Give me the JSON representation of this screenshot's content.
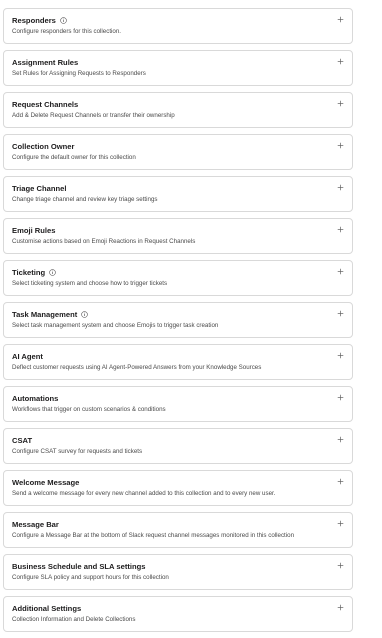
{
  "settings": [
    {
      "title": "Responders",
      "description": "Configure responders for this collection.",
      "has_info": true,
      "expand_icon": "plus-icon"
    },
    {
      "title": "Assignment Rules",
      "description": "Set Rules for Assigning Requests to Responders",
      "has_info": false,
      "expand_icon": "plus-icon"
    },
    {
      "title": "Request Channels",
      "description": "Add & Delete Request Channels or transfer their ownership",
      "has_info": false,
      "expand_icon": "plus-icon"
    },
    {
      "title": "Collection Owner",
      "description": "Configure the default owner for this collection",
      "has_info": false,
      "expand_icon": "plus-icon"
    },
    {
      "title": "Triage Channel",
      "description": "Change triage channel and review key triage settings",
      "has_info": false,
      "expand_icon": "plus-icon"
    },
    {
      "title": "Emoji Rules",
      "description": "Customise actions based on Emoji Reactions in Request Channels",
      "has_info": false,
      "expand_icon": "plus-icon"
    },
    {
      "title": "Ticketing",
      "description": "Select ticketing system and choose how to trigger tickets",
      "has_info": true,
      "expand_icon": "plus-icon"
    },
    {
      "title": "Task Management",
      "description": "Select task management system and choose Emojis to trigger task creation",
      "has_info": true,
      "expand_icon": "plus-icon"
    },
    {
      "title": "AI Agent",
      "description": "Deflect customer requests using AI Agent-Powered Answers from your Knowledge Sources",
      "has_info": false,
      "expand_icon": "plus-icon"
    },
    {
      "title": "Automations",
      "description": "Workflows that trigger on custom scenarios & conditions",
      "has_info": false,
      "expand_icon": "plus-icon"
    },
    {
      "title": "CSAT",
      "description": "Configure CSAT survey for requests and tickets",
      "has_info": false,
      "expand_icon": "plus-icon"
    },
    {
      "title": "Welcome Message",
      "description": "Send a welcome message for every new channel added to this collection and to every new user.",
      "has_info": false,
      "expand_icon": "plus-icon"
    },
    {
      "title": "Message Bar",
      "description": "Configure a Message Bar at the bottom of Slack request channel messages monitored in this collection",
      "has_info": false,
      "expand_icon": "plus-icon"
    },
    {
      "title": "Business Schedule and SLA settings",
      "description": "Configure SLA policy and support hours for this collection",
      "has_info": false,
      "expand_icon": "plus-icon"
    },
    {
      "title": "Additional Settings",
      "description": "Collection Information and Delete Collections",
      "has_info": false,
      "expand_icon": "plus-icon"
    }
  ],
  "colors": {
    "border": "#d9d9d9",
    "title": "#1d1c1d",
    "description": "#4a4a4a",
    "icon": "#616061"
  }
}
